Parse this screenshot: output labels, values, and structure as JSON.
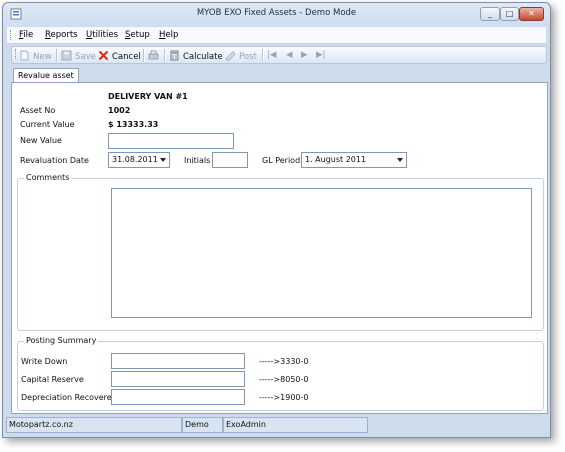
{
  "window": {
    "title": "MYOB EXO Fixed Assets - Demo Mode"
  },
  "menu": [
    {
      "pre": "",
      "key": "F",
      "post": "ile"
    },
    {
      "pre": "",
      "key": "R",
      "post": "eports"
    },
    {
      "pre": "",
      "key": "U",
      "post": "tilities"
    },
    {
      "pre": "",
      "key": "S",
      "post": "etup"
    },
    {
      "pre": "",
      "key": "H",
      "post": "elp"
    }
  ],
  "toolbar": {
    "new": "New",
    "save": "Save",
    "cancel": "Cancel",
    "calculate": "Calculate",
    "post": "Post"
  },
  "tab": {
    "label": "Revalue asset"
  },
  "asset": {
    "name": "DELIVERY VAN #1",
    "no_label": "Asset No",
    "no_value": "1002",
    "current_value_label": "Current Value",
    "current_value": "$ 13333.33",
    "new_value_label": "New Value",
    "new_value": ""
  },
  "revaluation": {
    "date_label": "Revaluation Date",
    "date_value": "31.08.2011",
    "initials_label": "Initials",
    "initials_value": "",
    "gl_period_label": "GL Period",
    "gl_period_value": "1. August 2011"
  },
  "comments": {
    "title": "Comments",
    "value": ""
  },
  "posting_summary": {
    "title": "Posting Summary",
    "rows": [
      {
        "label": "Write Down",
        "value": "",
        "account": "----->3330-0"
      },
      {
        "label": "Capital Reserve",
        "value": "",
        "account": "----->8050-0"
      },
      {
        "label": "Depreciation Recovered",
        "value": "",
        "account": "----->1900-0"
      }
    ]
  },
  "status": {
    "site": "Motopartz.co.nz",
    "mode": "Demo",
    "user": "ExoAdmin"
  },
  "colors": {
    "window_frame": "#cddbed",
    "cancel_red": "#d62a1e"
  }
}
